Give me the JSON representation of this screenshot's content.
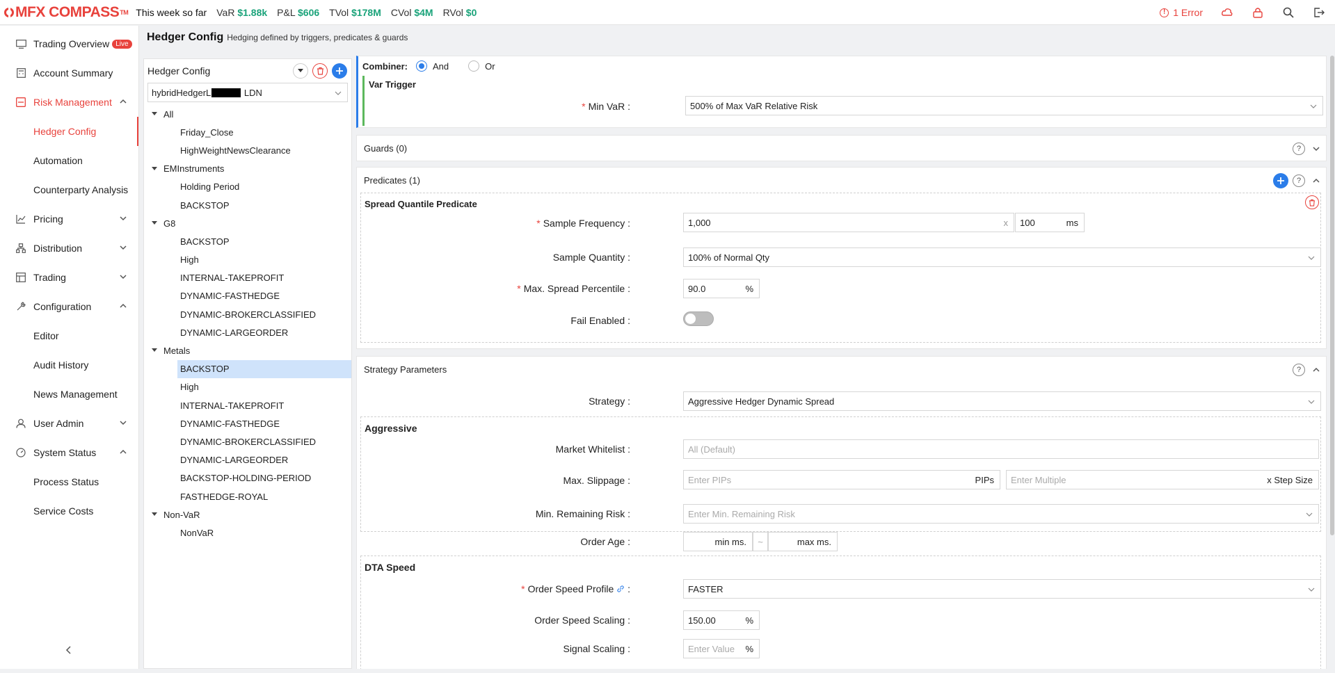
{
  "topbar": {
    "logo": "MFX COMPASS",
    "logo_tm": "TM",
    "week": "This week so far",
    "metrics": [
      {
        "label": "VaR",
        "value": "$1.88k"
      },
      {
        "label": "P&L",
        "value": "$606"
      },
      {
        "label": "TVol",
        "value": "$178M"
      },
      {
        "label": "CVol",
        "value": "$4M"
      },
      {
        "label": "RVol",
        "value": "$0"
      }
    ],
    "error": "1 Error",
    "error_icon": "!"
  },
  "sidebar": {
    "items": [
      {
        "label": "Trading Overview",
        "badge": "Live",
        "icon": "monitor-icon"
      },
      {
        "label": "Account Summary",
        "icon": "calculator-icon"
      },
      {
        "label": "Risk Management",
        "icon": "risk-icon"
      },
      {
        "label": "Hedger Config"
      },
      {
        "label": "Automation"
      },
      {
        "label": "Counterparty Analysis"
      },
      {
        "label": "Pricing",
        "icon": "chart-icon"
      },
      {
        "label": "Distribution",
        "icon": "distribution-icon"
      },
      {
        "label": "Trading",
        "icon": "trading-icon"
      },
      {
        "label": "Configuration",
        "icon": "wrench-icon"
      },
      {
        "label": "Editor"
      },
      {
        "label": "Audit History"
      },
      {
        "label": "News Management"
      },
      {
        "label": "User Admin",
        "icon": "user-icon"
      },
      {
        "label": "System Status",
        "icon": "gauge-icon"
      },
      {
        "label": "Process Status"
      },
      {
        "label": "Service Costs"
      }
    ]
  },
  "header": {
    "title": "Hedger Config",
    "subtitle": "Hedging defined by triggers, predicates & guards"
  },
  "tree_panel": {
    "title": "Hedger Config",
    "select_prefix": "hybridHedgerL",
    "select_suffix": "LDN",
    "groups": [
      {
        "name": "All",
        "children": [
          "Friday_Close",
          "HighWeightNewsClearance"
        ]
      },
      {
        "name": "EMInstruments",
        "children": [
          "Holding Period",
          "BACKSTOP"
        ]
      },
      {
        "name": "G8",
        "children": [
          "BACKSTOP",
          "High",
          "INTERNAL-TAKEPROFIT",
          "DYNAMIC-FASTHEDGE",
          "DYNAMIC-BROKERCLASSIFIED",
          "DYNAMIC-LARGEORDER"
        ]
      },
      {
        "name": "Metals",
        "children": [
          "BACKSTOP",
          "High",
          "INTERNAL-TAKEPROFIT",
          "DYNAMIC-FASTHEDGE",
          "DYNAMIC-BROKERCLASSIFIED",
          "DYNAMIC-LARGEORDER",
          "BACKSTOP-HOLDING-PERIOD",
          "FASTHEDGE-ROYAL"
        ]
      },
      {
        "name": "Non-VaR",
        "children": [
          "NonVaR"
        ]
      }
    ]
  },
  "combiner": {
    "label": "Combiner:",
    "options": [
      "And",
      "Or"
    ],
    "selected": "And"
  },
  "var_trigger": {
    "title": "Var Trigger",
    "min_var_label": "Min VaR",
    "min_var_value": "500% of Max VaR Relative Risk"
  },
  "guards": {
    "title": "Guards (0)"
  },
  "predicates": {
    "title": "Predicates (1)",
    "name": "Spread Quantile Predicate",
    "sample_frequency_label": "Sample Frequency",
    "sample_frequency_value": "1,000",
    "multiply": "x",
    "sample_frequency_ms": "100",
    "ms_unit": "ms",
    "sample_quantity_label": "Sample Quantity",
    "sample_quantity_value": "100% of Normal Qty",
    "max_spread_label": "Max. Spread Percentile",
    "max_spread_value": "90.0",
    "percent": "%",
    "fail_enabled_label": "Fail Enabled"
  },
  "strategy": {
    "title": "Strategy Parameters",
    "strategy_label": "Strategy",
    "strategy_value": "Aggressive Hedger Dynamic Spread",
    "aggressive_title": "Aggressive",
    "market_whitelist_label": "Market Whitelist",
    "market_whitelist_placeholder": "All (Default)",
    "max_slippage_label": "Max. Slippage",
    "pips_placeholder": "Enter PIPs",
    "pips_unit": "PIPs",
    "multiple_placeholder": "Enter Multiple",
    "step_unit": "x Step Size",
    "min_remaining_label": "Min. Remaining Risk",
    "min_remaining_placeholder": "Enter Min. Remaining Risk",
    "order_age_label": "Order Age",
    "min_ms": "min ms.",
    "tilde": "~",
    "max_ms": "max ms.",
    "dta_title": "DTA Speed",
    "order_speed_profile_label": "Order Speed Profile",
    "order_speed_profile_value": "FASTER",
    "order_speed_scaling_label": "Order Speed Scaling",
    "order_speed_scaling_value": "150.00",
    "signal_scaling_label": "Signal Scaling",
    "signal_scaling_placeholder": "Enter Value"
  },
  "colors": {
    "accent": "#e8423c",
    "primary": "#2b7de9",
    "positive": "#1aa37a"
  }
}
